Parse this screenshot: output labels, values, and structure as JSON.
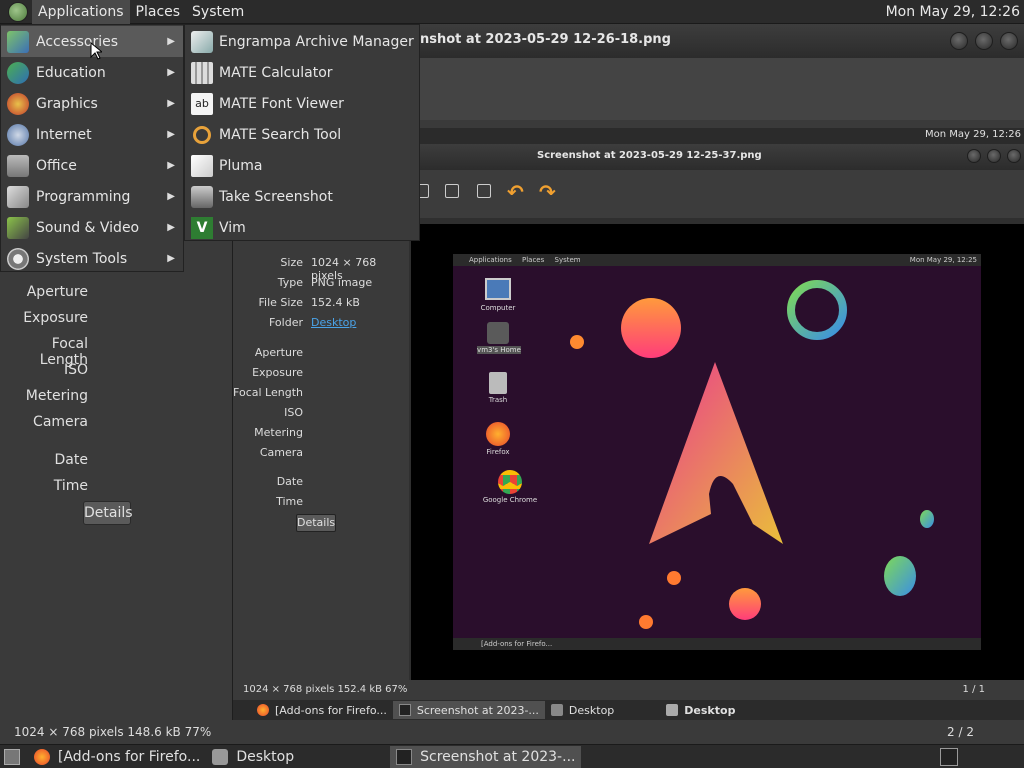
{
  "top_panel": {
    "menus": [
      "Applications",
      "Places",
      "System"
    ],
    "clock": "Mon May 29, 12:26"
  },
  "back_window": {
    "title": "nshot at 2023-05-29 12-26-18.png",
    "labels": [
      "Aperture",
      "Exposure",
      "Focal Length",
      "ISO",
      "Metering",
      "Camera",
      "Date",
      "Time"
    ],
    "details_button": "Details",
    "status": "1024 × 768 pixels  148.6 kB   77%",
    "pager": "2 / 2"
  },
  "inner_window": {
    "clock": "Mon May 29, 12:26",
    "title": "Screenshot at 2023-05-29 12-25-37.png",
    "props": [
      {
        "label": "Size",
        "value": "1024 × 768 pixels"
      },
      {
        "label": "Type",
        "value": "PNG image"
      },
      {
        "label": "File Size",
        "value": "152.4 kB"
      },
      {
        "label": "Folder",
        "value": "Desktop"
      }
    ],
    "labels": [
      "Aperture",
      "Exposure",
      "Focal Length",
      "ISO",
      "Metering",
      "Camera",
      "Date",
      "Time"
    ],
    "details_button": "Details",
    "status": "1024 × 768 pixels  152.4 kB   67%",
    "pager": "1 / 1",
    "tasks": [
      "[Add-ons for Firefo...",
      "Screenshot at 2023-...",
      "Desktop",
      "Desktop"
    ]
  },
  "thumbnail": {
    "panel_menus": [
      "Applications",
      "Places",
      "System"
    ],
    "clock": "Mon May 29, 12:25",
    "icons": [
      "Computer",
      "vm3's Home",
      "Trash",
      "Firefox",
      "Google Chrome"
    ],
    "task": "[Add-ons for Firefo..."
  },
  "app_menu": {
    "categories": [
      "Accessories",
      "Education",
      "Graphics",
      "Internet",
      "Office",
      "Programming",
      "Sound & Video",
      "System Tools"
    ],
    "accessories": [
      "Engrampa Archive Manager",
      "MATE Calculator",
      "MATE Font Viewer",
      "MATE Search Tool",
      "Pluma",
      "Take Screenshot",
      "Vim"
    ]
  },
  "bottom_panel": {
    "tasks": [
      "[Add-ons for Firefo...",
      "Desktop",
      "Screenshot at 2023-..."
    ]
  },
  "colors": {
    "panel": "#2b2b2b",
    "menu_bg": "#3a3a3a",
    "selected": "#5a5a5a",
    "link": "#4aa3e8",
    "accent_arrow": "#f0a030"
  }
}
